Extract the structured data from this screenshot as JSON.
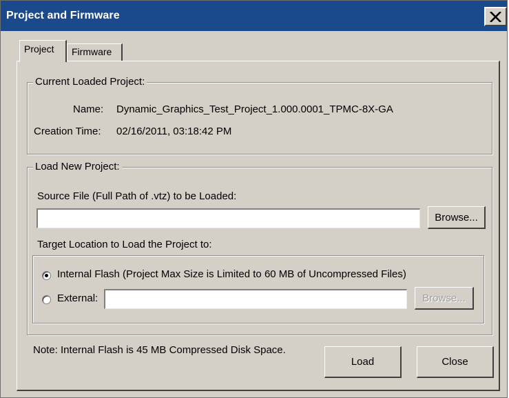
{
  "window": {
    "title": "Project and Firmware"
  },
  "tabs": [
    {
      "label": "Project",
      "active": true
    },
    {
      "label": "Firmware",
      "active": false
    }
  ],
  "current_project": {
    "legend": "Current Loaded Project:",
    "name_label": "Name:",
    "name_value": "Dynamic_Graphics_Test_Project_1.000.0001_TPMC-8X-GA",
    "creation_label": "Creation Time:",
    "creation_value": "02/16/2011, 03:18:42 PM"
  },
  "load_new": {
    "legend": "Load New Project:",
    "source_label": "Source File (Full Path of .vtz) to be Loaded:",
    "source_value": "",
    "browse_label": "Browse...",
    "target_label": "Target Location to Load the Project to:",
    "internal_label": "Internal Flash (Project Max Size is Limited to 60 MB of Uncompressed Files)",
    "internal_selected": true,
    "external_label": "External:",
    "external_value": "",
    "external_browse_label": "Browse..."
  },
  "footer": {
    "note": "Note: Internal Flash is 45 MB Compressed Disk Space.",
    "load_label": "Load",
    "close_label": "Close"
  },
  "colors": {
    "titlebar": "#1a4a8c",
    "face": "#d4d0c8"
  },
  "icons": {
    "close": "close-icon"
  }
}
